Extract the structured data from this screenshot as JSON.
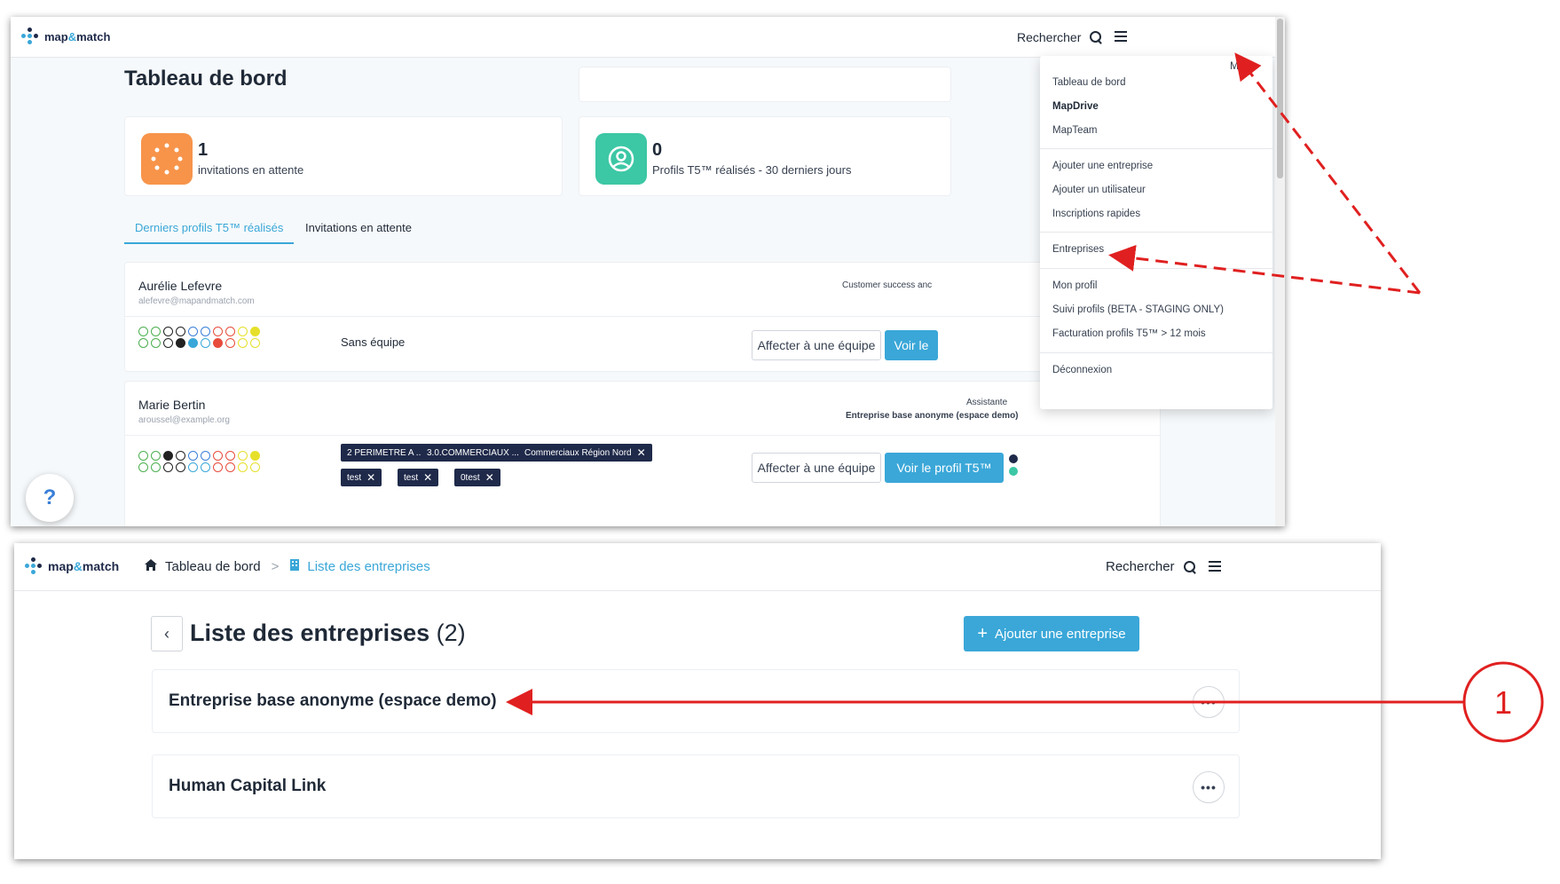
{
  "dashboard": {
    "brand": {
      "pre": "map",
      "amp": "&",
      "post": "match"
    },
    "search_label": "Rechercher",
    "title": "Tableau de bord",
    "stat1": {
      "value": "1",
      "label": "invitations en attente"
    },
    "stat2": {
      "value": "0",
      "label": "Profils T5™ réalisés - 30 derniers jours"
    },
    "tabs": [
      "Derniers profils T5™ réalisés",
      "Invitations en attente"
    ],
    "rows": [
      {
        "name": "Aurélie Lefevre",
        "email": "alefevre@mapandmatch.com",
        "role": "Customer success anc",
        "team": "Sans équipe",
        "assign": "Affecter à une équipe",
        "view": "Voir le"
      },
      {
        "name": "Marie Bertin",
        "email": "aroussel@example.org",
        "role": "Assistante",
        "company": "Entreprise base anonyme (espace demo)",
        "tags": [
          "2 PERIMETRE A ...",
          "3.0.COMMERCIAUX ...",
          "Commerciaux Région Nord"
        ],
        "tags2": [
          "test",
          "test",
          "0test"
        ],
        "assign": "Affecter à une équipe",
        "view": "Voir le profil T5™"
      }
    ],
    "help": "?",
    "tooltip": "Menu",
    "menu": {
      "groups": [
        [
          "Tableau de bord",
          "MapDrive",
          "MapTeam"
        ],
        [
          "Ajouter une entreprise",
          "Ajouter un utilisateur",
          "Inscriptions rapides"
        ],
        [
          "Entreprises"
        ],
        [
          "Mon profil",
          "Suivi profils (BETA - STAGING ONLY)",
          "Facturation profils T5™ > 12 mois"
        ],
        [
          "Déconnexion"
        ]
      ],
      "bold_item": "MapDrive"
    }
  },
  "companies": {
    "brand": {
      "pre": "map",
      "amp": "&",
      "post": "match"
    },
    "breadcrumb": [
      "Tableau de bord",
      "Liste des entreprises"
    ],
    "breadcrumb_sep": ">",
    "search_label": "Rechercher",
    "title": "Liste des entreprises",
    "count": "(2)",
    "add_button": "Ajouter une entreprise",
    "items": [
      "Entreprise base anonyme (espace demo)",
      "Human Capital Link"
    ],
    "more_icon": "•••"
  },
  "annotation": {
    "number": "1",
    "color": "#e02020"
  },
  "colors": {
    "accent": "#3aa7d8",
    "orange": "#f7944a",
    "teal": "#3cc7a5",
    "navy": "#1f2a4a"
  }
}
